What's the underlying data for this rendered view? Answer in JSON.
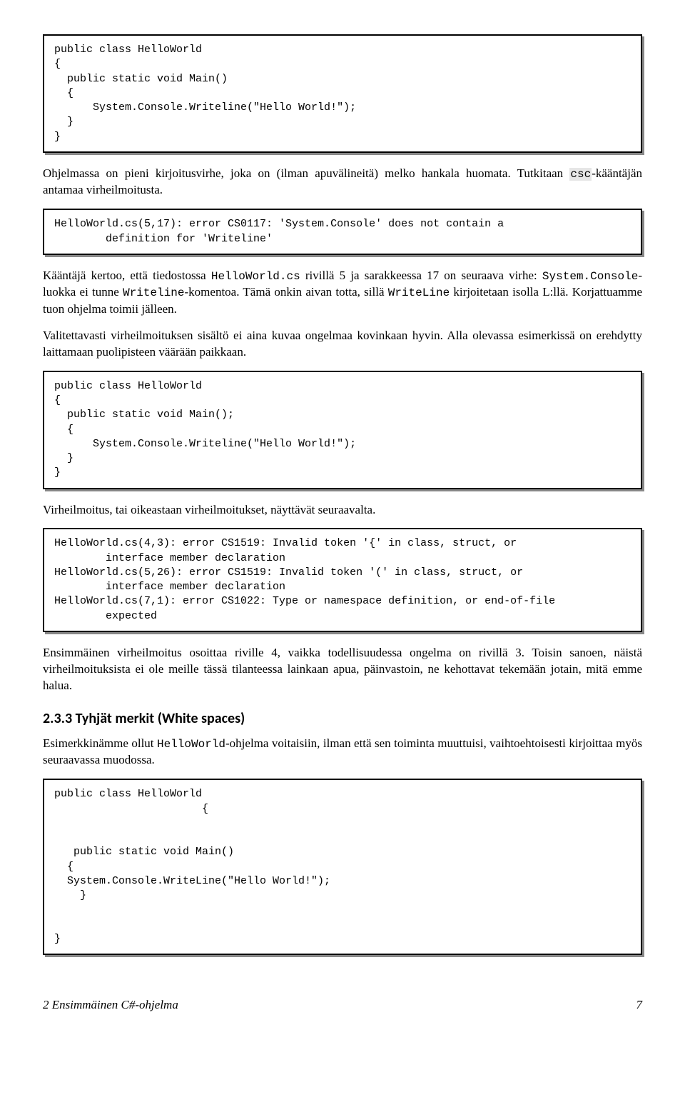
{
  "code1": "public class HelloWorld\n{\n  public static void Main()\n  {\n      System.Console.Writeline(\"Hello World!\");\n  }\n}",
  "para1a": "Ohjelmassa on pieni kirjoitusvirhe, joka on (ilman apuvälineitä) melko hankala huomata. Tutkitaan ",
  "para1b_mono": "csc",
  "para1c": "-kääntäjän antamaa virheilmoitusta.",
  "code2": "HelloWorld.cs(5,17): error CS0117: 'System.Console' does not contain a\n        definition for 'Writeline'",
  "para2a": "Kääntäjä kertoo, että tiedostossa ",
  "para2b_mono": "HelloWorld.cs",
  "para2c": " rivillä 5 ja sarakkeessa 17 on seuraava virhe: ",
  "para2d_mono": "System.Console",
  "para2e": "-luokka ei tunne ",
  "para2f_mono": "Writeline",
  "para2g": "-komentoa. Tämä onkin aivan totta, sillä ",
  "para2h_mono": "WriteLine",
  "para2i": " kirjoitetaan isolla L:llä. Korjattuamme tuon ohjelma toimii jälleen.",
  "para3": "Valitettavasti virheilmoituksen sisältö ei aina kuvaa ongelmaa kovinkaan hyvin. Alla olevassa esimerkissä on erehdytty laittamaan puolipisteen väärään paikkaan.",
  "code3": "public class HelloWorld\n{\n  public static void Main();\n  {\n      System.Console.Writeline(\"Hello World!\");\n  }\n}",
  "para4": "Virheilmoitus, tai oikeastaan virheilmoitukset, näyttävät seuraavalta.",
  "code4": "HelloWorld.cs(4,3): error CS1519: Invalid token '{' in class, struct, or\n        interface member declaration\nHelloWorld.cs(5,26): error CS1519: Invalid token '(' in class, struct, or\n        interface member declaration\nHelloWorld.cs(7,1): error CS1022: Type or namespace definition, or end-of-file\n        expected",
  "para5": "Ensimmäinen virheilmoitus osoittaa riville 4, vaikka todellisuudessa ongelma on rivillä 3. Toisin sanoen, näistä virheilmoituksista ei ole meille tässä tilanteessa lainkaan apua, päinvastoin, ne kehottavat tekemään jotain, mitä emme halua.",
  "section_heading": "2.3.3   Tyhjät merkit (White spaces)",
  "para6a": "Esimerkkinämme ollut ",
  "para6b_mono": "HelloWorld",
  "para6c": "-ohjelma voitaisiin, ilman että sen toiminta muuttuisi, vaihtoehtoisesti kirjoittaa myös seuraavassa muodossa.",
  "code5": "public class HelloWorld\n                       {\n\n\n   public static void Main()\n  {\n  System.Console.WriteLine(\"Hello World!\");\n    }\n\n\n}",
  "footer_left": "2 Ensimmäinen C#-ohjelma",
  "footer_right": "7"
}
